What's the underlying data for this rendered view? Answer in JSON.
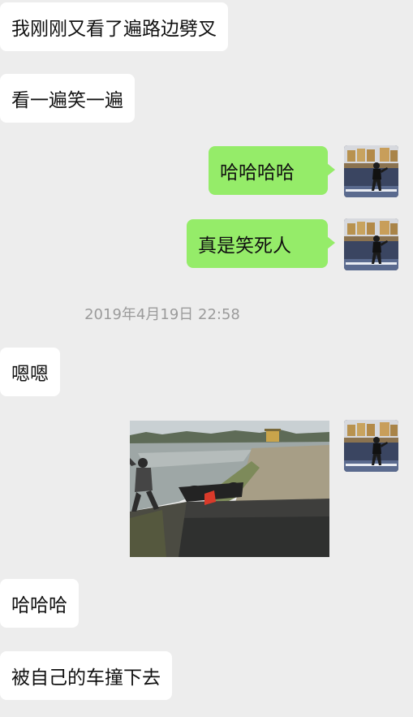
{
  "messages": [
    {
      "side": "incoming",
      "text": "我刚刚又看了遍路边劈叉"
    },
    {
      "side": "incoming",
      "text": "看一遍笑一遍"
    },
    {
      "side": "outgoing",
      "text": "哈哈哈哈"
    },
    {
      "side": "outgoing",
      "text": "真是笑死人"
    },
    {
      "side": "incoming",
      "text": "嗯嗯"
    },
    {
      "side": "outgoing",
      "type": "image"
    },
    {
      "side": "incoming",
      "text": "哈哈哈"
    },
    {
      "side": "incoming",
      "text": "被自己的车撞下去"
    }
  ],
  "timestamp": "2019年4月19日 22:58",
  "colors": {
    "background": "#ededed",
    "incoming_bubble": "#ffffff",
    "outgoing_bubble": "#95ec69",
    "timestamp_text": "#9b9b9b"
  },
  "icons": {
    "avatar": "user-avatar-photo"
  }
}
